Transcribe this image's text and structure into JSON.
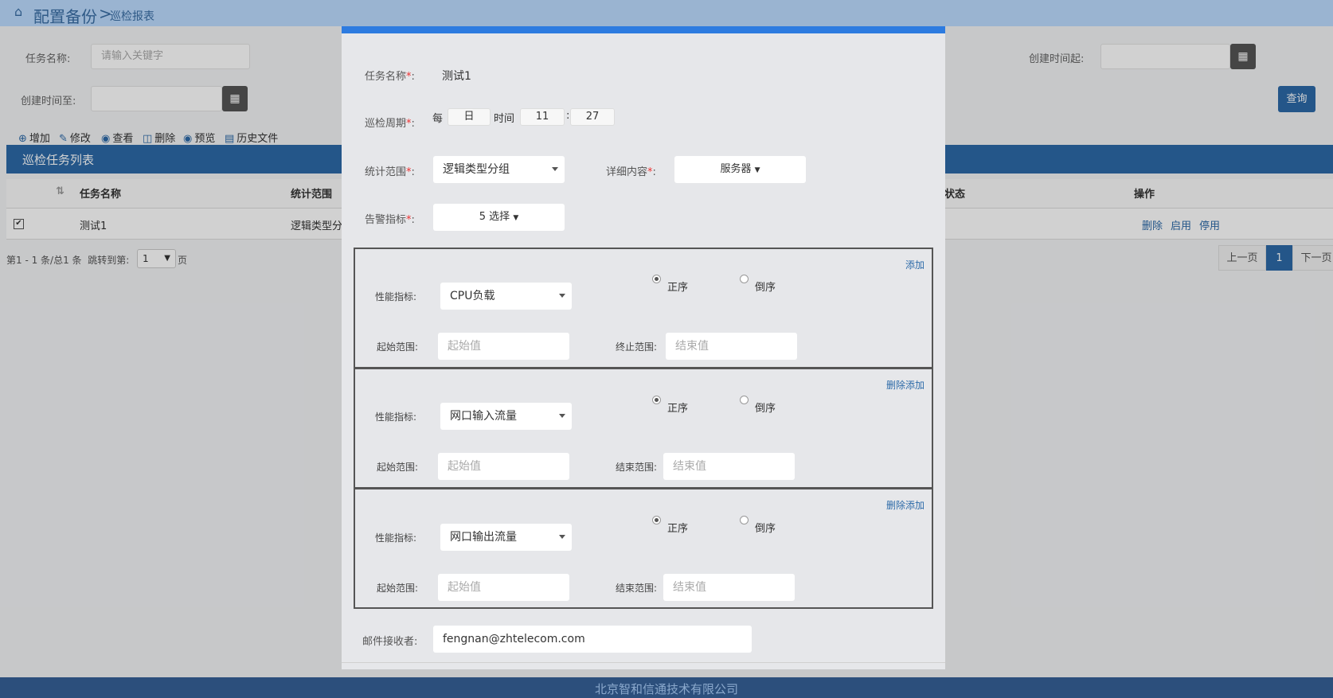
{
  "breadcrumb": {
    "main": "配置备份",
    "sep": ">",
    "sub": "巡检报表"
  },
  "search": {
    "task_name_label": "任务名称:",
    "task_name_placeholder": "请输入关键字",
    "created_from_label": "创建时间起:",
    "created_to_label": "创建时间至:",
    "query_label": "查询"
  },
  "toolbar": [
    {
      "icon": "plus-circle-icon",
      "label": "增加"
    },
    {
      "icon": "edit-icon",
      "label": "修改"
    },
    {
      "icon": "eye-icon",
      "label": "查看"
    },
    {
      "icon": "trash-icon",
      "label": "删除"
    },
    {
      "icon": "eye-icon",
      "label": "预览"
    },
    {
      "icon": "table-icon",
      "label": "历史文件"
    }
  ],
  "list": {
    "title": "巡检任务列表",
    "columns": [
      "任务名称",
      "统计范围",
      "状态",
      "操作"
    ],
    "rows": [
      {
        "checked": true,
        "name": "测试1",
        "scope": "逻辑类型分",
        "actions": [
          "删除",
          "启用",
          "停用"
        ]
      }
    ]
  },
  "pager": {
    "info": "第1 - 1 条/总1 条",
    "jump_label": "跳转到第:",
    "jump_value": "1",
    "page_suffix": "页",
    "prev": "上一页",
    "current": "1",
    "next": "下一页"
  },
  "modal": {
    "task_name_label": "任务名称",
    "task_name_value": "测试1",
    "cycle_label": "巡检周期",
    "cycle_every": "每",
    "cycle_unit": "日",
    "cycle_time_label": "时间",
    "cycle_hour": "11",
    "cycle_colon": ":",
    "cycle_minute": "27",
    "scope_label": "统计范围",
    "scope_value": "逻辑类型分组",
    "detail_label": "详细内容",
    "detail_value": "服务器",
    "alarm_label": "告警指标",
    "alarm_value": "5 选择",
    "required_mark": "*",
    "colon": ":",
    "panels": [
      {
        "link": "添加",
        "metric_label": "性能指标:",
        "metric": "CPU负载",
        "asc": "正序",
        "desc": "倒序",
        "asc_selected": true,
        "start_label": "起始范围:",
        "start_placeholder": "起始值",
        "end_label": "终止范围:",
        "end_placeholder": "结束值"
      },
      {
        "link": "删除添加",
        "metric_label": "性能指标:",
        "metric": "网口输入流量",
        "asc": "正序",
        "desc": "倒序",
        "asc_selected": true,
        "start_label": "起始范围:",
        "start_placeholder": "起始值",
        "end_label": "结束范围:",
        "end_placeholder": "结束值"
      },
      {
        "link": "删除添加",
        "metric_label": "性能指标:",
        "metric": "网口输出流量",
        "asc": "正序",
        "desc": "倒序",
        "asc_selected": true,
        "start_label": "起始范围:",
        "start_placeholder": "起始值",
        "end_label": "结束范围:",
        "end_placeholder": "结束值"
      }
    ],
    "mail_label": "邮件接收者:",
    "mail_value": "fengnan@zhtelecom.com"
  },
  "footer": {
    "text": "北京智和信通技术有限公司"
  },
  "colors": {
    "accent": "#2c6aa8",
    "modal_top": "#2d7be0",
    "header_bg": "#bcdcff",
    "footer_bg": "#2c4f7c"
  }
}
